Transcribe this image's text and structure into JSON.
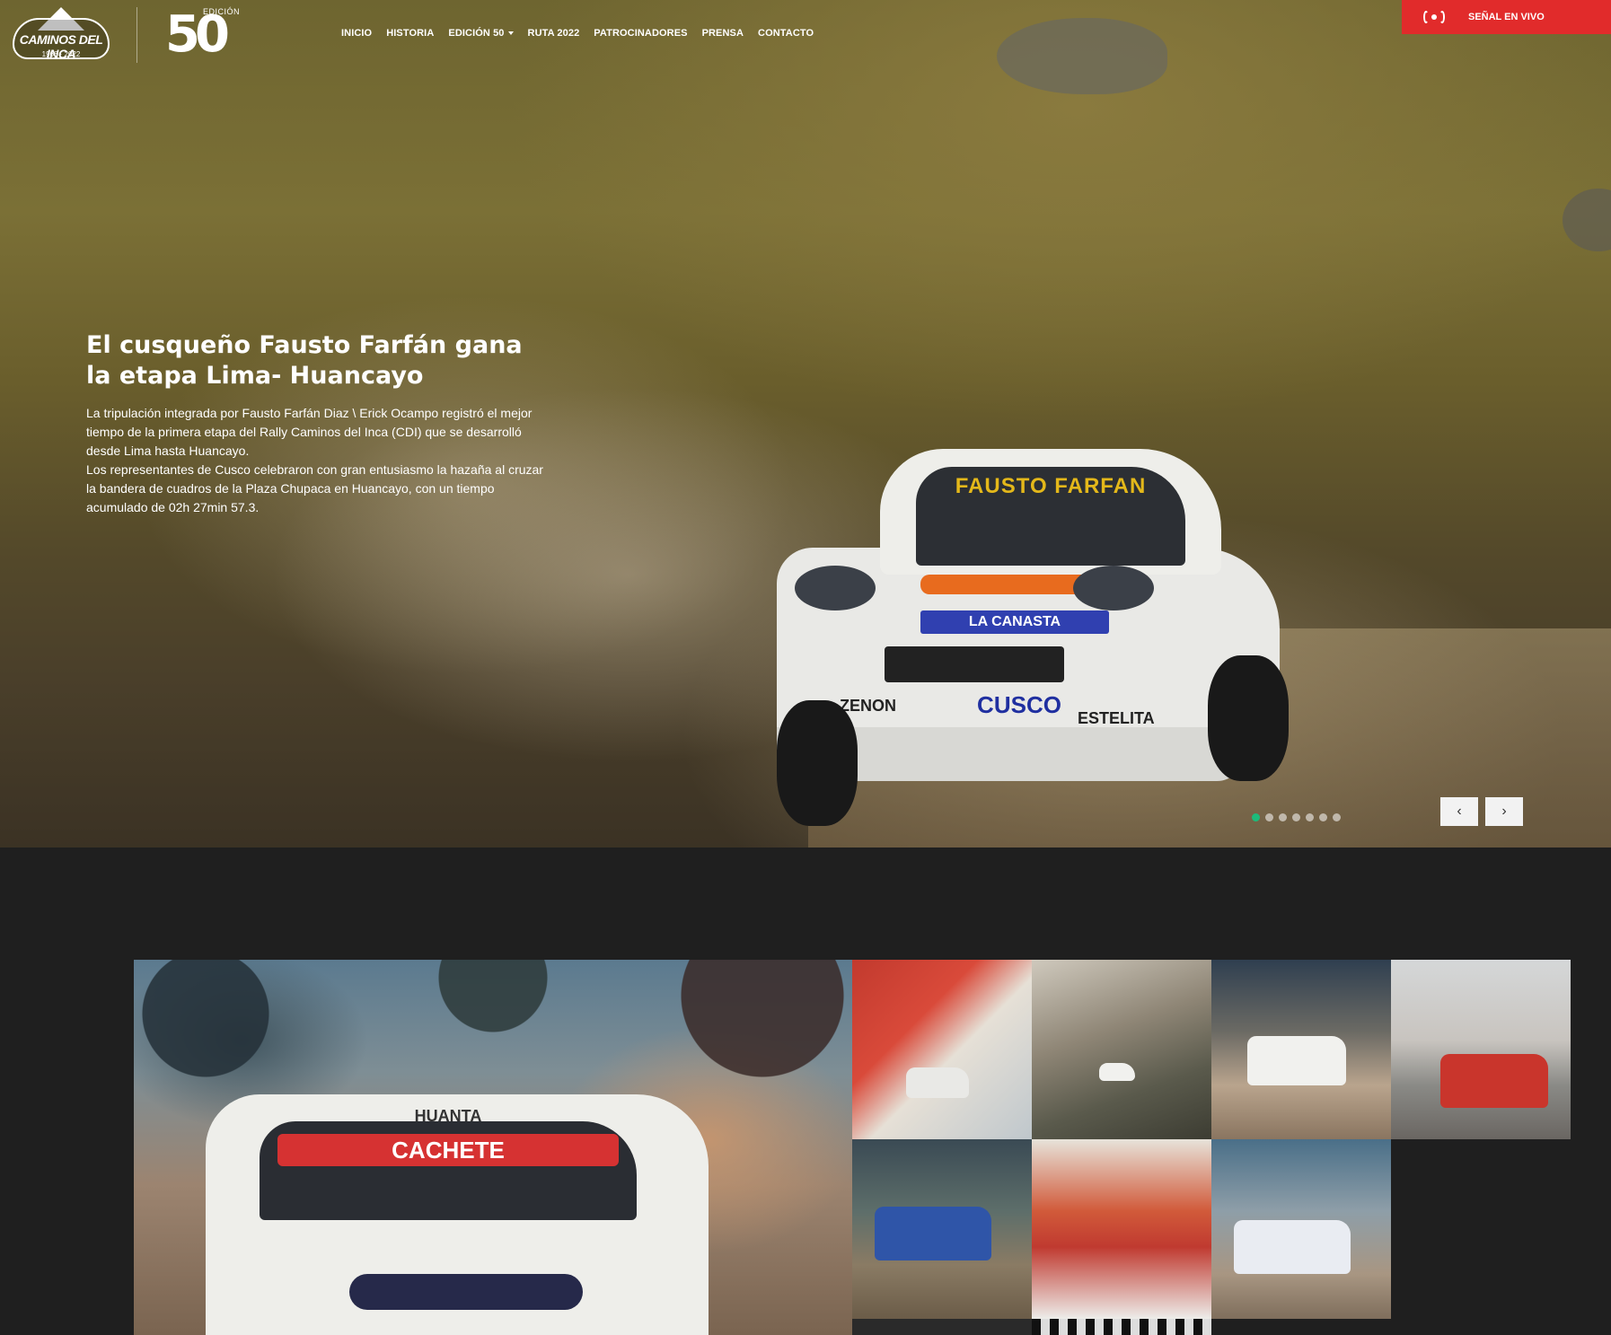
{
  "header": {
    "logo_text": "CAMINOS DEL INCA",
    "logo_sub": "1966 · 2022",
    "edition_number": "50",
    "edition_label": "EDICIÓN",
    "nav": [
      {
        "label": "INICIO"
      },
      {
        "label": "HISTORIA"
      },
      {
        "label": "EDICIÓN 50",
        "dropdown": true
      },
      {
        "label": "RUTA 2022"
      },
      {
        "label": "PATROCINADORES"
      },
      {
        "label": "PRENSA"
      },
      {
        "label": "CONTACTO"
      }
    ],
    "live_button": "SEÑAL EN VIVO",
    "live_icon": "broadcast-icon",
    "accent_color": "#e12b2b"
  },
  "hero": {
    "title": "El cusqueño Fausto Farfán gana la etapa Lima- Huancayo",
    "paragraph1": "La tripulación integrada por Fausto Farfán Diaz \\ Erick Ocampo registró el mejor tiempo de la primera etapa del Rally Caminos del Inca (CDI) que se desarrolló desde Lima hasta Huancayo.",
    "paragraph2": "Los representantes de Cusco celebraron con gran entusiasmo la hazaña al cruzar la bandera de cuadros de la Plaza Chupaca en Huancayo, con un tiempo acumulado de 02h 27min 57.3.",
    "car_banner": "FAUSTO FARFAN",
    "car_plate": "LA CANASTA",
    "car_front": "CUSCO",
    "car_left": "ZENON",
    "car_right": "ESTELITA",
    "slides_count": 7,
    "active_slide": 1,
    "indicator_active_color": "#1dbb7a",
    "prev_label": "‹",
    "next_label": "›"
  },
  "gallery": {
    "main_top": "HUANTA",
    "main_banner": "CACHETE"
  }
}
